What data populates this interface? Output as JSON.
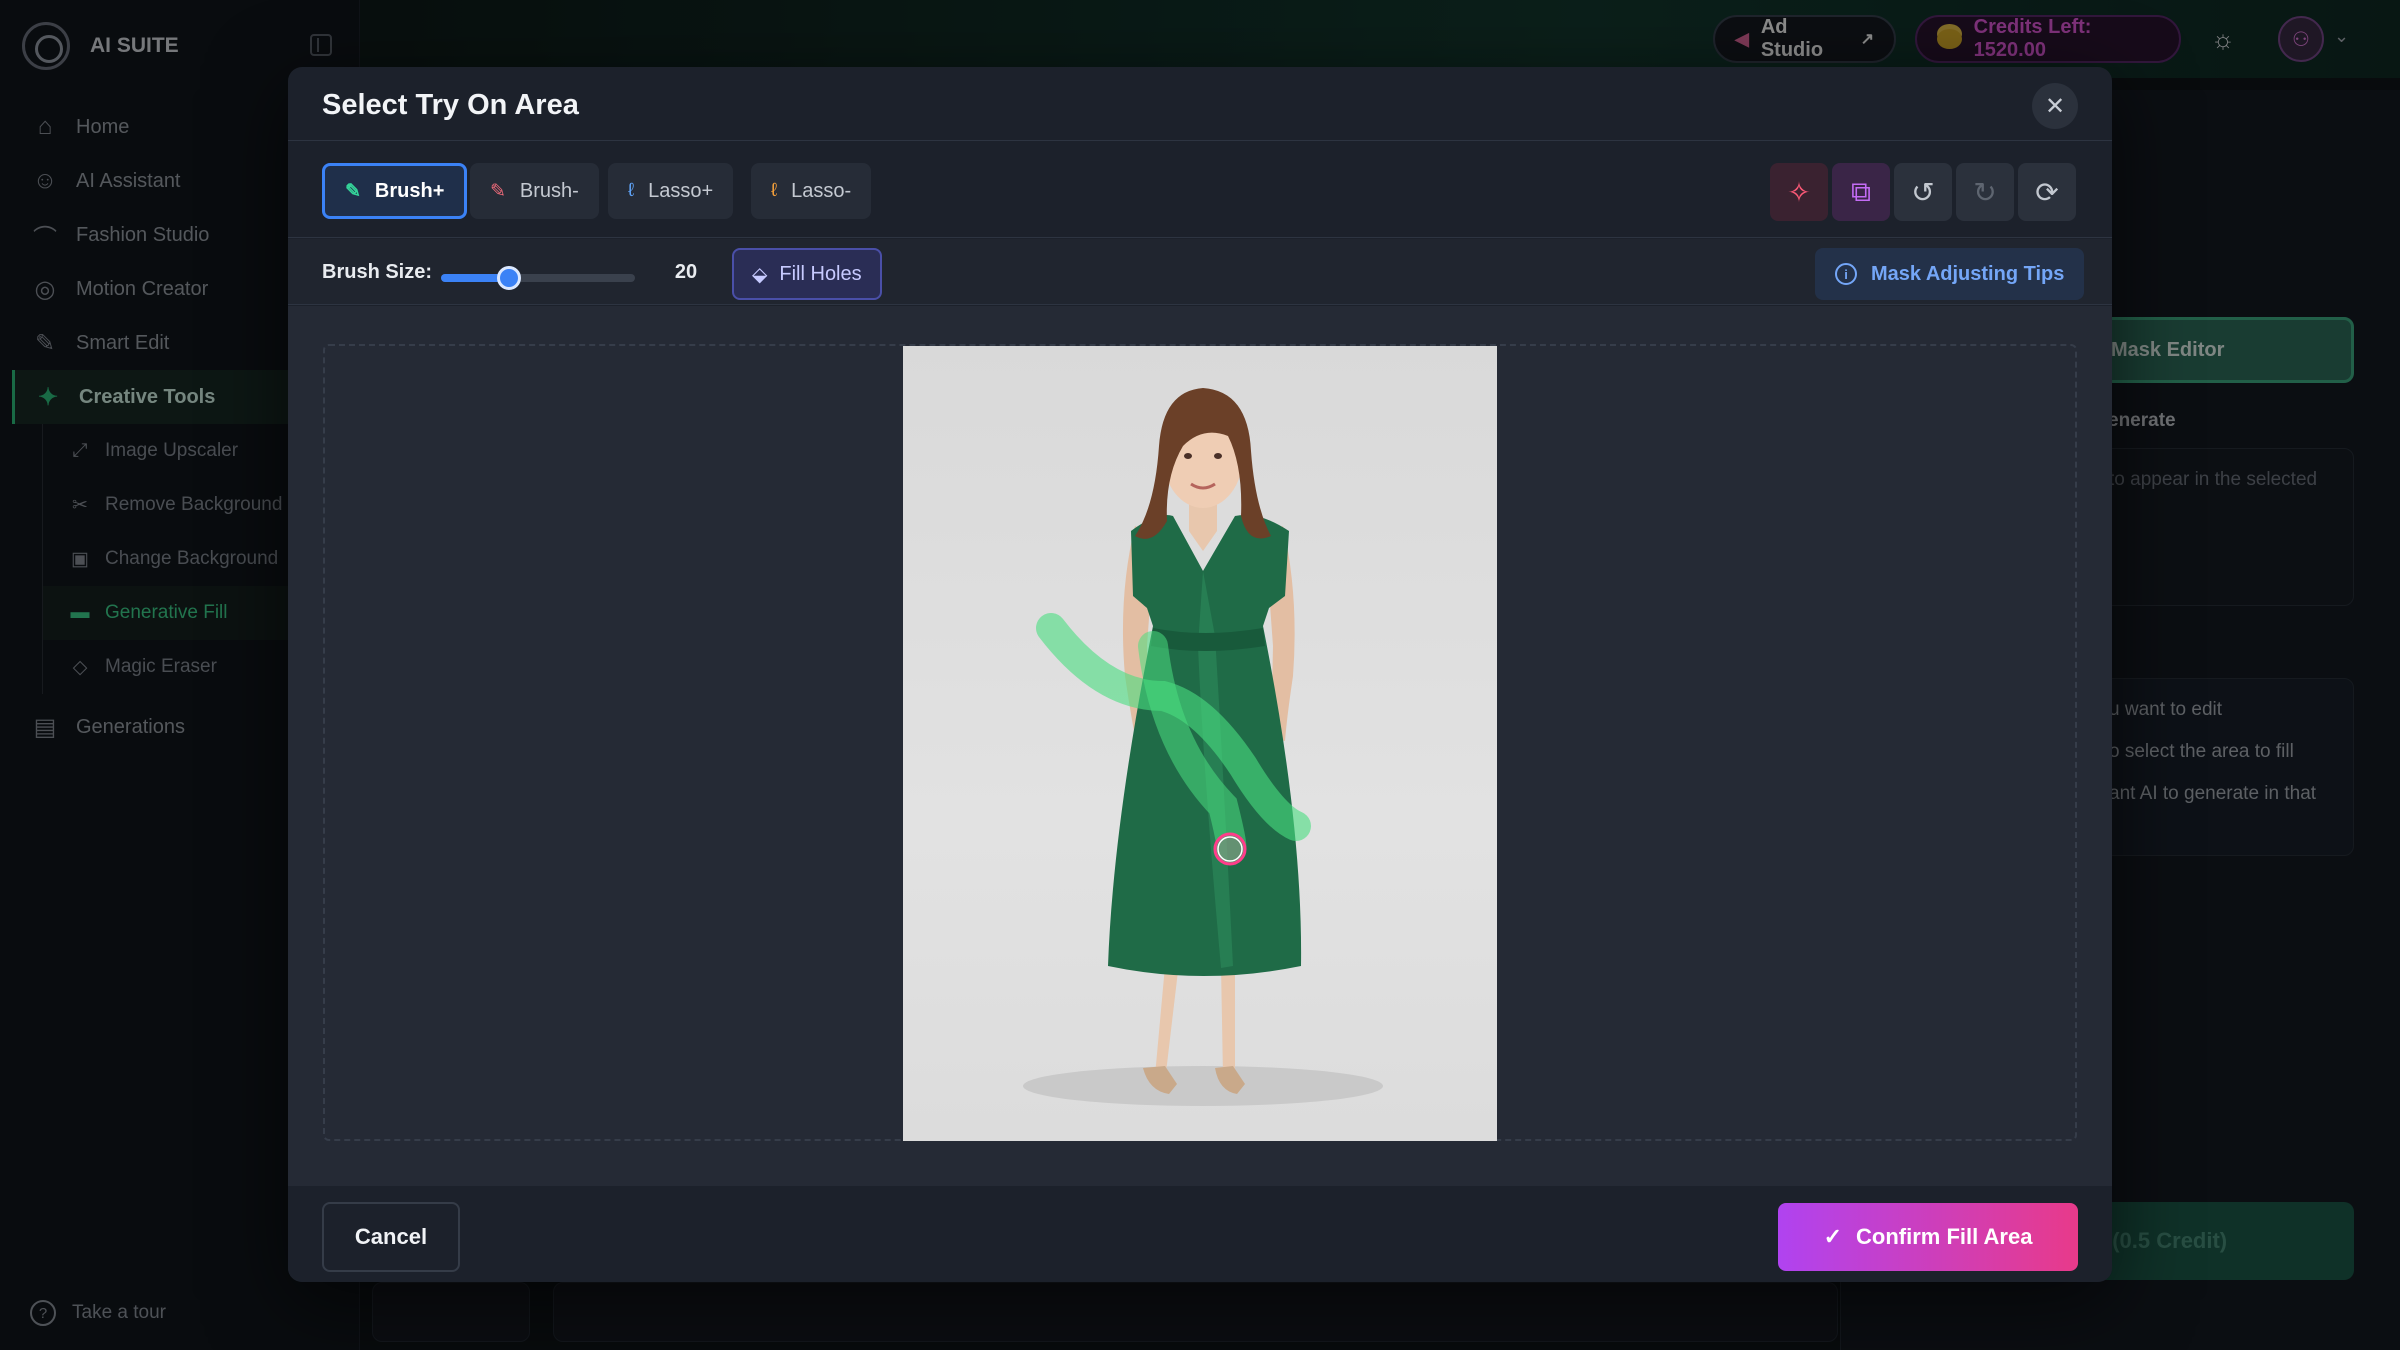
{
  "app": {
    "brand": "AI SUITE"
  },
  "sidebar": {
    "items": [
      {
        "label": "Home",
        "icon": "home-icon"
      },
      {
        "label": "AI Assistant",
        "icon": "robot-icon"
      },
      {
        "label": "Fashion Studio",
        "icon": "hanger-icon"
      },
      {
        "label": "Motion Creator",
        "icon": "motion-icon"
      },
      {
        "label": "Smart Edit",
        "icon": "magic-wand-icon"
      },
      {
        "label": "Creative Tools",
        "icon": "wand-icon",
        "active": true
      }
    ],
    "sub_items": [
      {
        "label": "Image Upscaler",
        "icon": "upscale-icon"
      },
      {
        "label": "Remove Background",
        "icon": "scissors-icon"
      },
      {
        "label": "Change Background",
        "icon": "image-icon"
      },
      {
        "label": "Generative Fill",
        "icon": "paint-roller-icon",
        "active": true
      },
      {
        "label": "Magic Eraser",
        "icon": "eraser-icon"
      }
    ],
    "generations": {
      "label": "Generations",
      "icon": "gallery-icon"
    },
    "tour": "Take a tour"
  },
  "topbar": {
    "ad_studio": "Ad Studio",
    "credits": "Credits Left: 1520.00"
  },
  "right_panel": {
    "mask_editor": "Mask Editor",
    "generate_label": "enerate",
    "prompt_hint": "to appear in the selected",
    "steps": [
      "u want to edit",
      "o select the area to fill",
      "ant AI to generate in that"
    ],
    "generate_button": "l (0.5 Credit)"
  },
  "modal": {
    "title": "Select Try On Area",
    "close_icon": "close-icon",
    "tools": [
      {
        "label": "Brush+",
        "icon": "brush-icon",
        "active": true
      },
      {
        "label": "Brush-",
        "icon": "brush-icon"
      },
      {
        "label": "Lasso+",
        "icon": "lasso-icon"
      },
      {
        "label": "Lasso-",
        "icon": "lasso-icon"
      }
    ],
    "action_icons": [
      "sparkle-icon",
      "compare-icon",
      "undo-icon",
      "redo-icon",
      "reset-icon"
    ],
    "brush": {
      "label": "Brush Size:",
      "value": "20",
      "level": 0.35
    },
    "fill_holes": "Fill Holes",
    "tips": "Mask Adjusting Tips",
    "cancel": "Cancel",
    "confirm": "Confirm Fill Area"
  },
  "colors": {
    "accent": "#3b82f6",
    "brand_green": "#2ec27e",
    "mask_green": "#4ade80",
    "confirm_start": "#b043f0",
    "confirm_end": "#e83a8a",
    "credits": "#e85be0"
  }
}
